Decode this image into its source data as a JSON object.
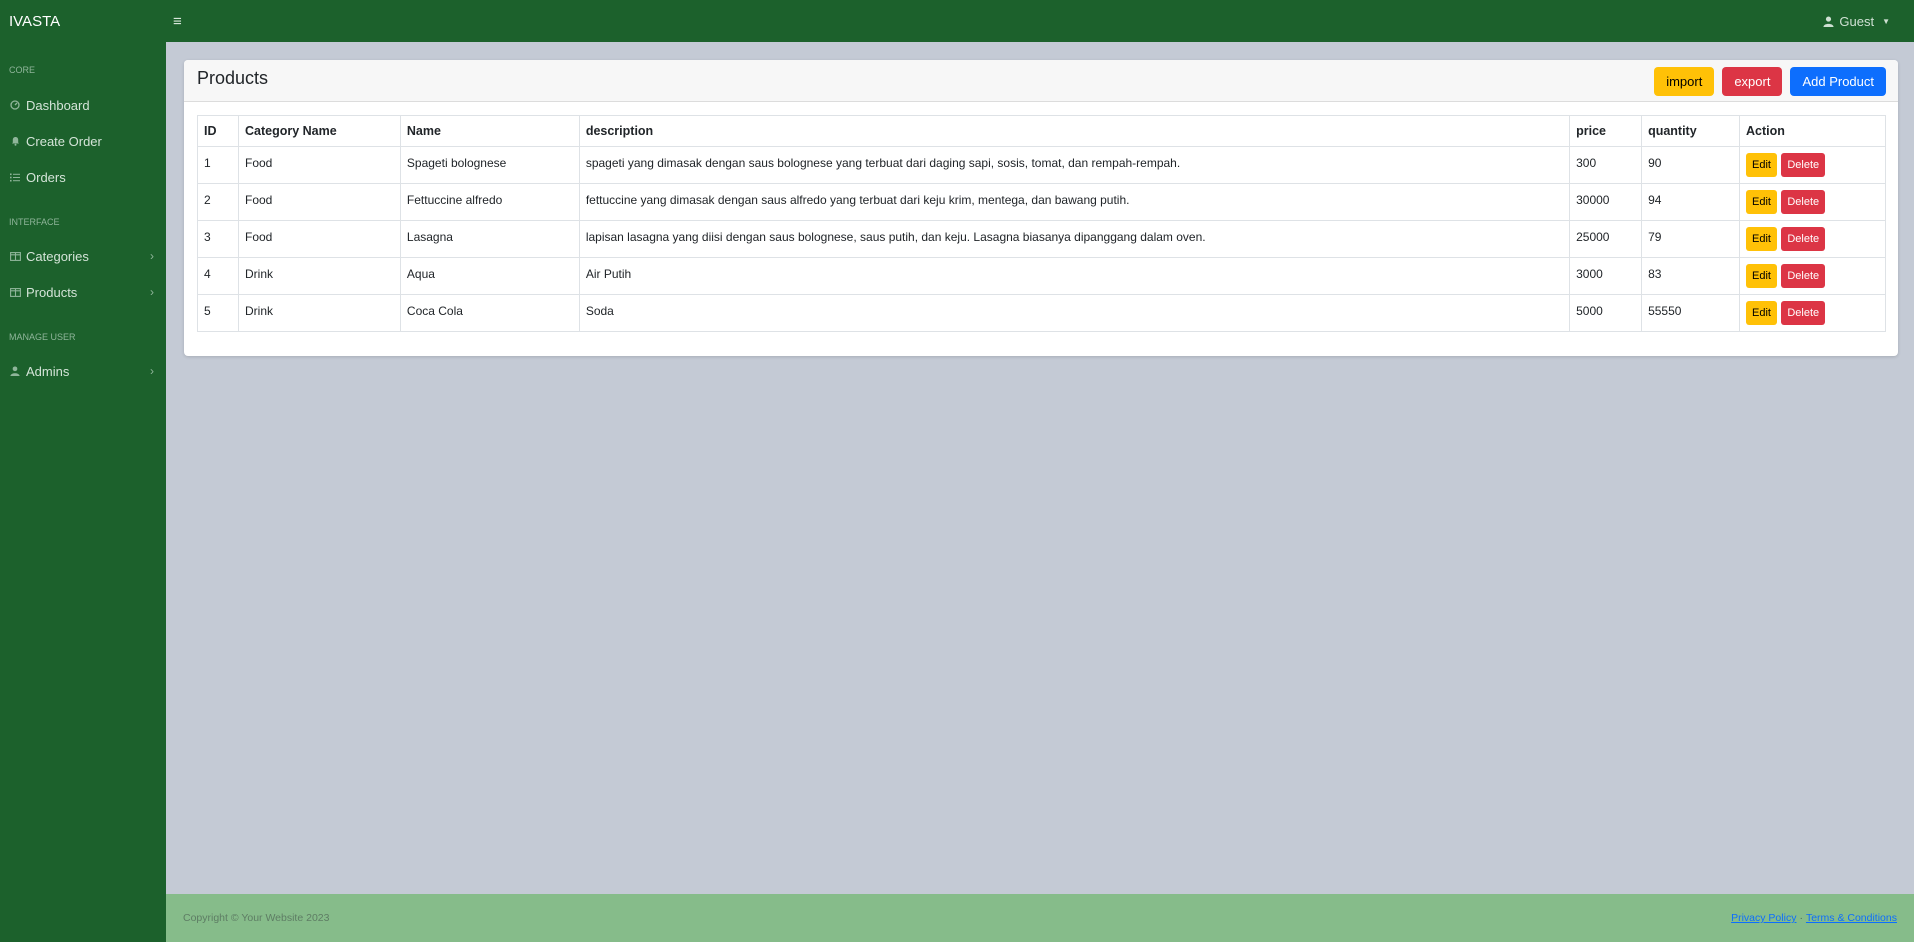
{
  "navbar": {
    "brand": "IVASTA",
    "toggle_icon": "hamburger-icon",
    "user_label": "Guest",
    "user_icon": "user-icon"
  },
  "sidebar": {
    "core_heading": "CORE",
    "core_items": [
      {
        "label": "Dashboard",
        "icon": "dashboard-icon"
      },
      {
        "label": "Create Order",
        "icon": "bell-icon"
      },
      {
        "label": "Orders",
        "icon": "list-icon"
      }
    ],
    "interface_heading": "INTERFACE",
    "interface_items": [
      {
        "label": "Categories",
        "icon": "columns-icon"
      },
      {
        "label": "Products",
        "icon": "columns-icon"
      }
    ],
    "manage_heading": "MANAGE USER",
    "manage_items": [
      {
        "label": "Admins",
        "icon": "user-icon"
      }
    ]
  },
  "main": {
    "title": "Products",
    "buttons": {
      "import": "import",
      "export": "export",
      "add": "Add Product"
    },
    "table": {
      "headers": [
        "ID",
        "Category Name",
        "Name",
        "description",
        "price",
        "quantity",
        "Action"
      ],
      "rows": [
        {
          "id": "1",
          "category": "Food",
          "name": "Spageti bolognese",
          "description": "spageti yang dimasak dengan saus bolognese yang terbuat dari daging sapi, sosis, tomat, dan rempah-rempah.",
          "price": "300",
          "quantity": "90"
        },
        {
          "id": "2",
          "category": "Food",
          "name": "Fettuccine alfredo",
          "description": "fettuccine yang dimasak dengan saus alfredo yang terbuat dari keju krim, mentega, dan bawang putih.",
          "price": "30000",
          "quantity": "94"
        },
        {
          "id": "3",
          "category": "Food",
          "name": "Lasagna",
          "description": "lapisan lasagna yang diisi dengan saus bolognese, saus putih, dan keju. Lasagna biasanya dipanggang dalam oven.",
          "price": "25000",
          "quantity": "79"
        },
        {
          "id": "4",
          "category": "Drink",
          "name": "Aqua",
          "description": "Air Putih",
          "price": "3000",
          "quantity": "83"
        },
        {
          "id": "5",
          "category": "Drink",
          "name": "Coca Cola",
          "description": "Soda",
          "price": "5000",
          "quantity": "55550"
        }
      ],
      "edit_label": "Edit",
      "delete_label": "Delete"
    }
  },
  "footer": {
    "copyright": "Copyright © Your Website 2023",
    "privacy": "Privacy Policy",
    "separator": "·",
    "terms": "Terms & Conditions"
  },
  "colors": {
    "sidebar_bg": "#1c612c",
    "footer_bg": "#86bc8a",
    "page_bg": "#c4cad5",
    "warning": "#ffc107",
    "danger": "#dc3545",
    "primary": "#0d6efd"
  }
}
